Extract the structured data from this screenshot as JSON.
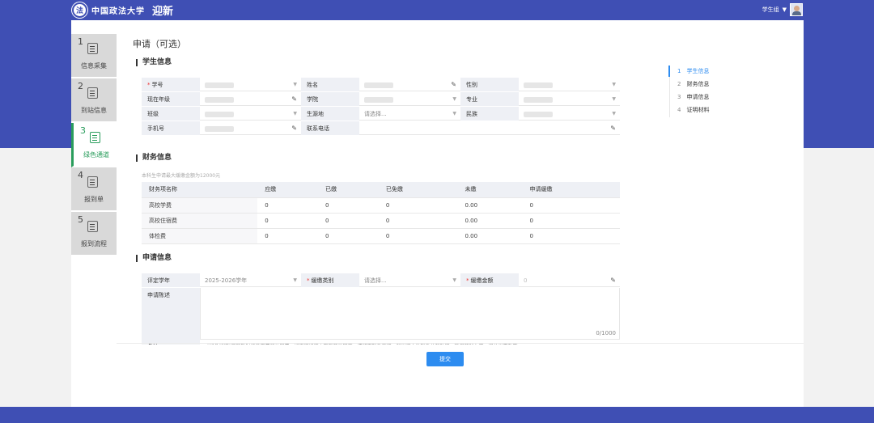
{
  "header": {
    "logo_text": "中国政法大学",
    "app_title": "迎新",
    "user_name": "学生组"
  },
  "steps": [
    {
      "num": "1",
      "label": "信息采集",
      "icon": "clipboard-icon"
    },
    {
      "num": "2",
      "label": "到站信息",
      "icon": "calendar-icon"
    },
    {
      "num": "3",
      "label": "绿色通道",
      "icon": "calendar-icon"
    },
    {
      "num": "4",
      "label": "报到单",
      "icon": "id-card-icon"
    },
    {
      "num": "5",
      "label": "报到流程",
      "icon": "bell-icon"
    }
  ],
  "page_title": "申请（可选）",
  "student_section": {
    "title": "学生信息",
    "rows": [
      [
        {
          "label": "学号",
          "required": true,
          "type": "dropdown"
        },
        {
          "label": "姓名",
          "type": "text"
        },
        {
          "label": "性别",
          "type": "dropdown"
        }
      ],
      [
        {
          "label": "现在年级",
          "type": "text"
        },
        {
          "label": "学院",
          "type": "dropdown"
        },
        {
          "label": "专业",
          "type": "dropdown"
        }
      ],
      [
        {
          "label": "班级",
          "type": "dropdown"
        },
        {
          "label": "生源地",
          "type": "dropdown",
          "value": "请选择..."
        },
        {
          "label": "民族",
          "type": "dropdown"
        }
      ],
      [
        {
          "label": "手机号",
          "type": "text"
        },
        {
          "label": "联系电话",
          "type": "text-wide"
        }
      ]
    ]
  },
  "finance_section": {
    "title": "财务信息",
    "hint": "本科生申请最大缓缴金额为12000元",
    "columns": [
      "财务项名称",
      "应缴",
      "已缴",
      "已免缴",
      "未缴",
      "申请缓缴"
    ],
    "rows": [
      [
        "高校学费",
        "0",
        "0",
        "0",
        "0.00",
        "0"
      ],
      [
        "高校住宿费",
        "0",
        "0",
        "0",
        "0.00",
        "0"
      ],
      [
        "体检费",
        "0",
        "0",
        "0",
        "0.00",
        "0"
      ]
    ]
  },
  "apply_section": {
    "title": "申请信息",
    "year_label": "评定学年",
    "year_value": "2025-2026学年",
    "type_label": "缓缴类别",
    "type_placeholder": "请选择...",
    "amount_label": "缓缴金额",
    "amount_placeholder": "0",
    "reason_label": "申请陈述",
    "counter": "0/1000",
    "note_label": "备注",
    "note_text": "\"绿色通道\"只能暂时缓缴学费和住宿费，如果您经济上存在其他困难，请留下联系方式，我们将主动联系并帮助您，确保顺利入学。相关优惠政策"
  },
  "submit_label": "提交",
  "anchors": [
    {
      "num": "1",
      "label": "学生信息",
      "active": true
    },
    {
      "num": "2",
      "label": "财务信息",
      "active": false
    },
    {
      "num": "3",
      "label": "申请信息",
      "active": false
    },
    {
      "num": "4",
      "label": "证明材料",
      "active": false
    }
  ],
  "colors": {
    "primary": "#3f4fb4",
    "active_step": "#2a9d5c",
    "accent": "#2d8cf0"
  }
}
